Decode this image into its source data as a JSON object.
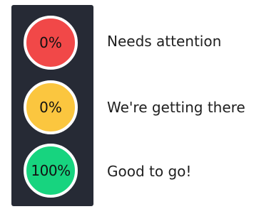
{
  "status_lights": [
    {
      "color": "#f14848",
      "percent_text": "0%",
      "label": "Needs attention"
    },
    {
      "color": "#fbc63f",
      "percent_text": "0%",
      "label": "We're getting there"
    },
    {
      "color": "#17d47f",
      "percent_text": "100%",
      "label": "Good to go!"
    }
  ]
}
